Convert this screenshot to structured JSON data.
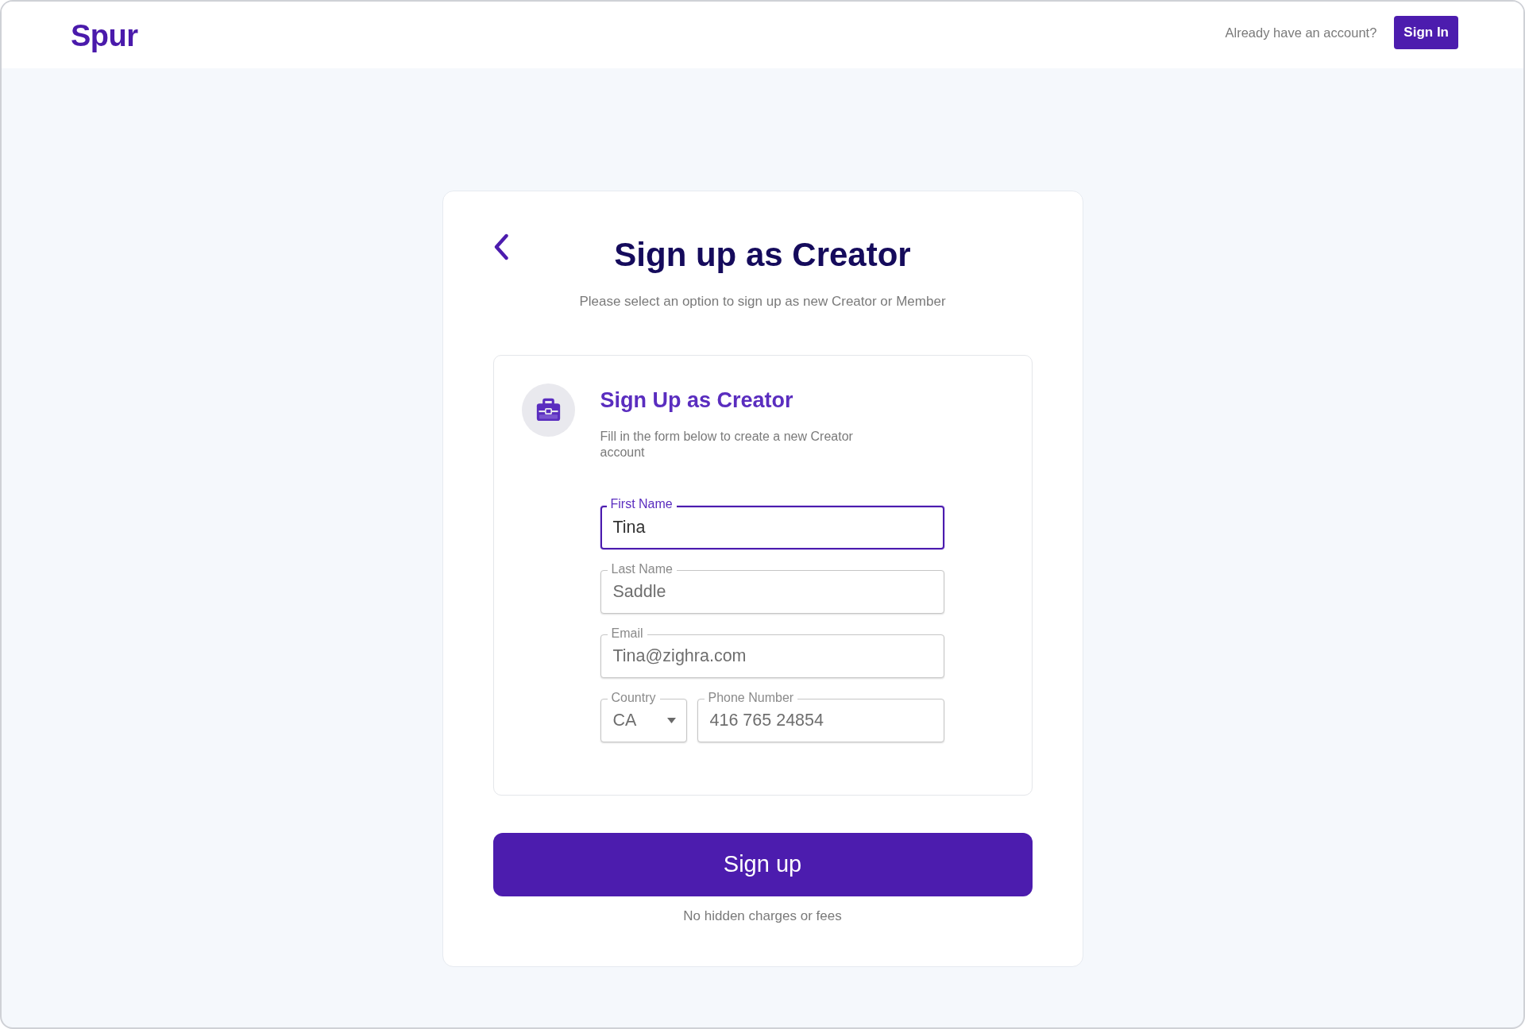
{
  "header": {
    "logo": "Spur",
    "account_prompt": "Already have an account?",
    "sign_in_button": "Sign In"
  },
  "signup_card": {
    "title": "Sign up as Creator",
    "subtitle": "Please select an option to sign up as new Creator or Member",
    "option": {
      "title": "Sign Up as Creator",
      "description": "Fill in the form below to create a new Creator account",
      "field_rows": [
        [
          {
            "kind": "text",
            "label": "First Name",
            "value": "Tina",
            "focused": true
          }
        ],
        [
          {
            "kind": "text",
            "label": "Last Name",
            "value": "Saddle",
            "focused": false
          }
        ],
        [
          {
            "kind": "text",
            "label": "Email",
            "value": "Tina@zighra.com",
            "focused": false
          }
        ],
        [
          {
            "kind": "select",
            "label": "Country",
            "value": "CA",
            "focused": false
          },
          {
            "kind": "text",
            "label": "Phone Number",
            "value": "416 765 24854",
            "focused": false
          }
        ]
      ]
    },
    "submit_button": "Sign up",
    "note": "No hidden charges or fees"
  }
}
